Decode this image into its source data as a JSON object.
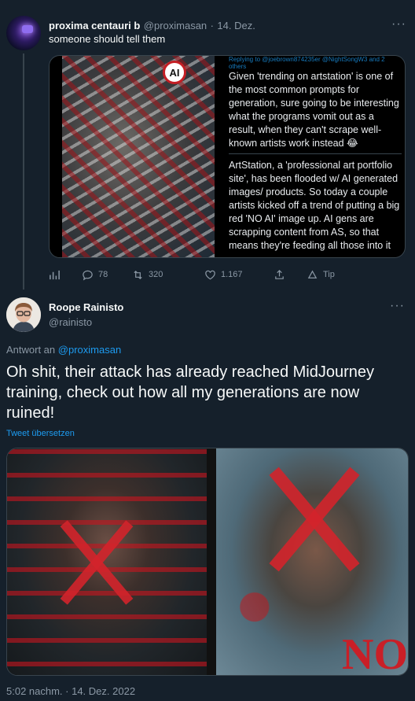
{
  "tweet1": {
    "display_name": "proxima centauri b",
    "handle": "@proximasan",
    "separator": "·",
    "date": "14. Dez.",
    "more": "···",
    "text": "someone should tell them",
    "quote": {
      "reply_line": "Replying to @joebrown874235er @NightSongW3 and 2 others",
      "paragraph1": "Given 'trending on artstation' is one of the most common prompts for generation, sure going to be interesting what the programs vomit out as a result, when they can't scrape well-known artists work instead 😂",
      "paragraph2": "ArtStation, a 'professional art portfolio site', has been flooded w/ AI generated images/ products. So today a couple artists kicked off a trend of putting a big red 'NO AI' image up. AI gens are scrapping content from AS, so that means they're feeding all those into it",
      "badge_text": "AI"
    },
    "actions": {
      "replies": "78",
      "retweets": "320",
      "likes": "1.167",
      "tip": "Tip"
    }
  },
  "tweet2": {
    "display_name": "Roope Rainisto",
    "handle": "@rainisto",
    "more": "···",
    "reply_prefix": "Antwort an",
    "reply_to": "@proximasan",
    "text": "Oh shit, their attack has already reached MidJourney training, check out how all my generations are now ruined!",
    "translate": "Tweet übersetzen",
    "image2_text": "NO",
    "timestamp": "5:02 nachm. · 14. Dez. 2022"
  },
  "icons": {
    "analytics": "analytics-icon",
    "reply": "reply-icon",
    "retweet": "retweet-icon",
    "like": "heart-icon",
    "share": "share-icon",
    "tip": "tip-icon"
  },
  "colors": {
    "background": "#15202b",
    "accent": "#1d9bf0",
    "muted": "#8b98a5",
    "border": "#38444d"
  }
}
